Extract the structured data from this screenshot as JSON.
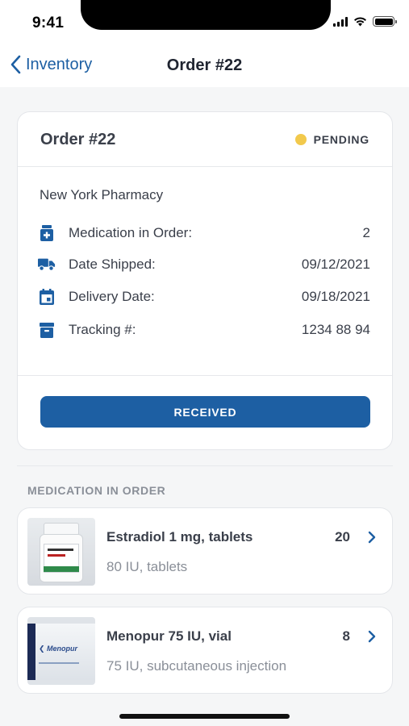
{
  "status_bar": {
    "time": "9:41"
  },
  "nav": {
    "back_label": "Inventory",
    "title": "Order #22"
  },
  "order": {
    "title": "Order #22",
    "status": "PENDING",
    "status_color": "#f2c94c",
    "pharmacy": "New York Pharmacy",
    "rows": [
      {
        "icon": "medication-icon",
        "label": "Medication in Order:",
        "value": "2"
      },
      {
        "icon": "truck-icon",
        "label": "Date Shipped:",
        "value": "09/12/2021"
      },
      {
        "icon": "calendar-icon",
        "label": "Delivery Date:",
        "value": "09/18/2021"
      },
      {
        "icon": "archive-box-icon",
        "label": "Tracking #:",
        "value": "1234 88 94"
      }
    ],
    "received_label": "RECEIVED"
  },
  "medications": {
    "section_title": "MEDICATION IN ORDER",
    "items": [
      {
        "name": "Estradiol 1 mg, tablets",
        "detail": "80 IU, tablets",
        "qty": "20",
        "thumb": "pill-bottle"
      },
      {
        "name": "Menopur 75 IU, vial",
        "detail": "75 IU, subcutaneous injection",
        "qty": "8",
        "thumb": "medicine-box"
      }
    ]
  },
  "colors": {
    "accent": "#1d5fa3",
    "text": "#3a3f4a",
    "muted": "#8a8f98"
  }
}
